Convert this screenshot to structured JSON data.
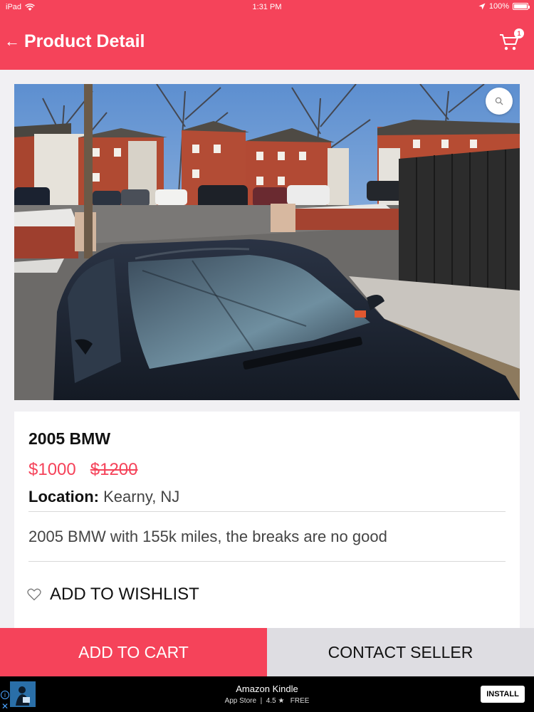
{
  "status_bar": {
    "device": "iPad",
    "time": "1:31 PM",
    "battery": "100%"
  },
  "header": {
    "title": "Product Detail",
    "back_icon": "arrow-left-icon",
    "cart_icon": "cart-icon",
    "cart_count": "1"
  },
  "product": {
    "image_alt": "car photo",
    "name": "2005 BMW",
    "price": "$1000",
    "old_price": "$1200",
    "location_label": "Location:",
    "location_value": "Kearny, NJ",
    "description": "2005 BMW with 155k miles, the breaks are no good"
  },
  "wishlist": {
    "label": "ADD TO WISHLIST",
    "icon": "heart-outline-icon"
  },
  "actions": {
    "add_to_cart": "ADD TO CART",
    "contact_seller": "CONTACT SELLER"
  },
  "ad": {
    "title": "Amazon Kindle",
    "store": "App Store",
    "rating": "4.5",
    "price": "FREE",
    "install_label": "INSTALL"
  },
  "colors": {
    "accent": "#f5435a",
    "secondary_button": "#dedde2",
    "background": "#f1f0f3"
  }
}
